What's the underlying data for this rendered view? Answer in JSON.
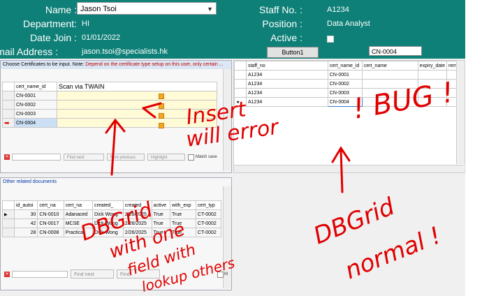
{
  "header": {
    "name_label": "Name :",
    "name_value": "Jason Tsoi",
    "department_label": "Department:",
    "department_value": "HI",
    "date_join_label": "Date Join :",
    "date_join_value": "01/01/2022",
    "email_label": "Email Address :",
    "email_value": "jason.tsoi@specialists.hk",
    "staff_no_label": "Staff No. :",
    "staff_no_value": "A1234",
    "position_label": "Position :",
    "position_value": "Data Analyst",
    "active_label": "Active :",
    "button1_label": "Button1",
    "edit_value": "CN-0004"
  },
  "cert_panel": {
    "title_prefix": "Choose Certificates to be input. Note: ",
    "title_note": "Depend on the certificate type setup on this user, only certain ...",
    "col_header": "cert_name_id",
    "scan_header": "Scan via TWAIN",
    "rows": [
      "CN-0001",
      "CN-0002",
      "CN-0003",
      "CN-0004"
    ],
    "find_next": "Find next",
    "find_previous": "Find previous",
    "highlight": "Highlight",
    "match_case": "Match case"
  },
  "staff_grid": {
    "columns": [
      "staff_no",
      "cert_name_id",
      "cert_name",
      "expiry_date",
      "remir"
    ],
    "rows": [
      [
        "A1234",
        "CN-0001"
      ],
      [
        "A1234",
        "CN-0002"
      ],
      [
        "A1234",
        "CN-0003"
      ],
      [
        "A1234",
        "CN-0004"
      ]
    ]
  },
  "docs_panel": {
    "title": "Other related documents",
    "columns": [
      "id_autoi",
      "cert_na",
      "cert_na",
      "created_",
      "created_",
      "active",
      "with_exp",
      "cert_typ"
    ],
    "rows": [
      [
        "30",
        "CN-0010",
        "Adanaced",
        "Dick Wong",
        "2/26/2025",
        "True",
        "True",
        "CT-0002"
      ],
      [
        "42",
        "CN-0017",
        "MCSE",
        "Dick Wong",
        "2/26/2025",
        "True",
        "True",
        "CT-0002"
      ],
      [
        "28",
        "CN-0008",
        "Practical",
        "Dick Wong",
        "2/26/2025",
        "True",
        "True",
        "CT-0002"
      ]
    ],
    "find_next": "Find next",
    "find_previous": "Find",
    "match_case": "M"
  },
  "annotations": {
    "insert_error": "Insert will error! BUG!",
    "dbgrid_lookup": "DBGrid with one field with lookup others",
    "dbgrid_normal": "DBGrid normal",
    "ink_color": "#e00000"
  }
}
